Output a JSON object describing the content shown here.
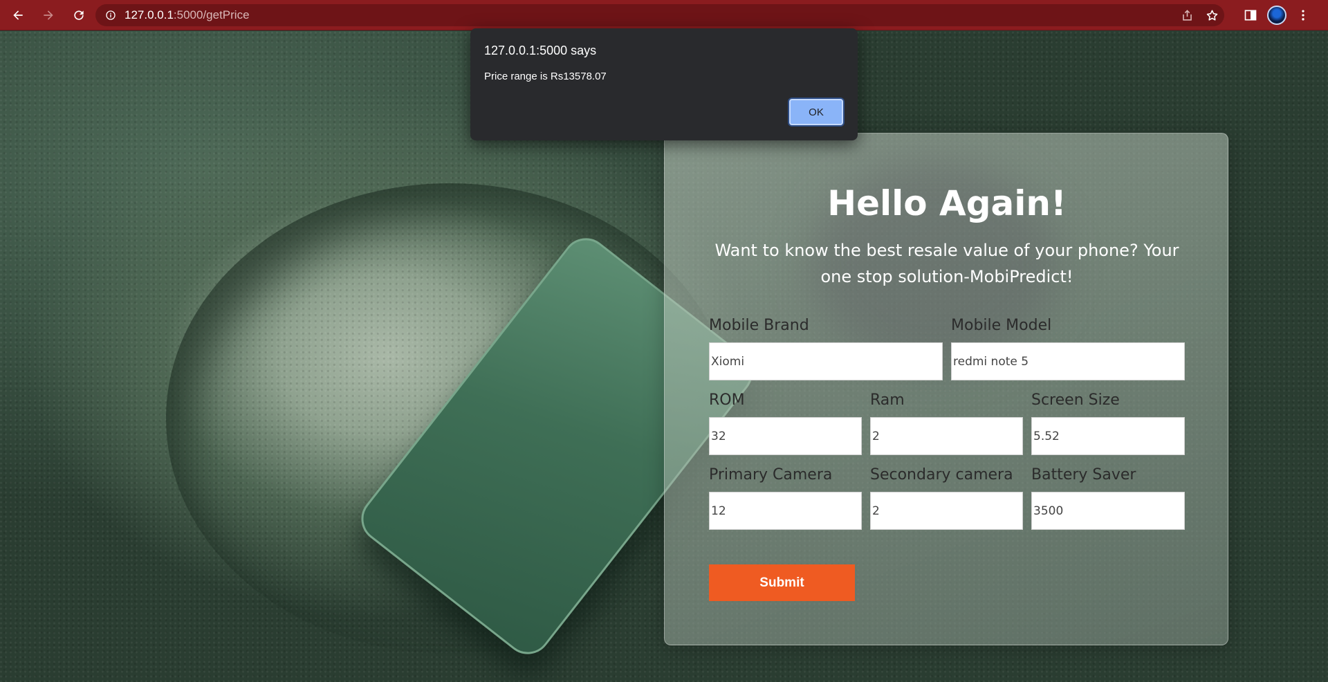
{
  "browser": {
    "url_host": "127.0.0.1",
    "url_path": ":5000/getPrice"
  },
  "page": {
    "heading": "Hello Again!",
    "subtitle": "Want to know the best resale value of your phone? Your one stop solution-MobiPredict!",
    "fields": {
      "brand": {
        "label": "Mobile Brand",
        "value": "Xiomi"
      },
      "model": {
        "label": "Mobile Model",
        "value": "redmi note 5"
      },
      "rom": {
        "label": "ROM",
        "value": "32"
      },
      "ram": {
        "label": "Ram",
        "value": "2"
      },
      "screen": {
        "label": "Screen Size",
        "value": "5.52"
      },
      "primary_camera": {
        "label": "Primary Camera",
        "value": "12"
      },
      "secondary_camera": {
        "label": "Secondary camera",
        "value": "2"
      },
      "battery": {
        "label": "Battery Saver",
        "value": "3500"
      }
    },
    "submit_label": "Submit"
  },
  "dialog": {
    "title": "127.0.0.1:5000 says",
    "message": "Price range is Rs13578.07",
    "ok_label": "OK"
  },
  "icons": {
    "back": "arrow-left-icon",
    "forward": "arrow-right-icon",
    "reload": "reload-icon",
    "site_info": "info-icon",
    "share": "share-icon",
    "bookmark": "star-icon",
    "side_panel": "side-panel-icon",
    "menu": "kebab-menu-icon"
  },
  "colors": {
    "toolbar": "#8b1c1f",
    "submit_button": "#ef5b22",
    "dialog_bg": "#292a2d",
    "ok_button": "#8ab4f8"
  }
}
